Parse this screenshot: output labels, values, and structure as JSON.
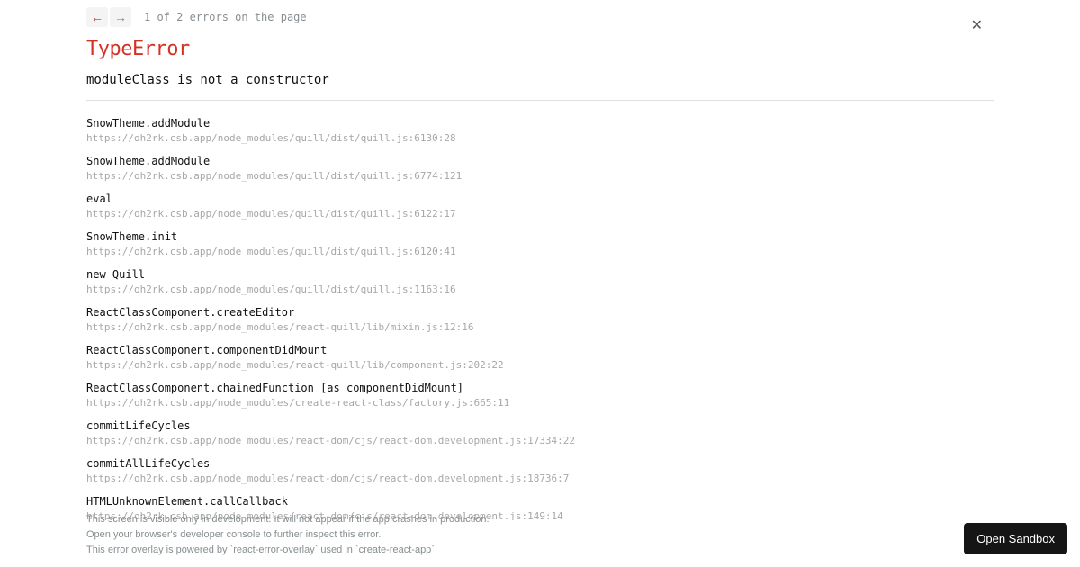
{
  "nav": {
    "prev_glyph": "←",
    "next_glyph": "→",
    "count_label": "1 of 2 errors on the page",
    "close_glyph": "✕"
  },
  "error": {
    "type": "TypeError",
    "message": "moduleClass is not a constructor"
  },
  "frames": [
    {
      "fn": "SnowTheme.addModule",
      "loc": "https://oh2rk.csb.app/node_modules/quill/dist/quill.js:6130:28"
    },
    {
      "fn": "SnowTheme.addModule",
      "loc": "https://oh2rk.csb.app/node_modules/quill/dist/quill.js:6774:121"
    },
    {
      "fn": "eval",
      "loc": "https://oh2rk.csb.app/node_modules/quill/dist/quill.js:6122:17"
    },
    {
      "fn": "SnowTheme.init",
      "loc": "https://oh2rk.csb.app/node_modules/quill/dist/quill.js:6120:41"
    },
    {
      "fn": "new Quill",
      "loc": "https://oh2rk.csb.app/node_modules/quill/dist/quill.js:1163:16"
    },
    {
      "fn": "ReactClassComponent.createEditor",
      "loc": "https://oh2rk.csb.app/node_modules/react-quill/lib/mixin.js:12:16"
    },
    {
      "fn": "ReactClassComponent.componentDidMount",
      "loc": "https://oh2rk.csb.app/node_modules/react-quill/lib/component.js:202:22"
    },
    {
      "fn": "ReactClassComponent.chainedFunction [as componentDidMount]",
      "loc": "https://oh2rk.csb.app/node_modules/create-react-class/factory.js:665:11"
    },
    {
      "fn": "commitLifeCycles",
      "loc": "https://oh2rk.csb.app/node_modules/react-dom/cjs/react-dom.development.js:17334:22"
    },
    {
      "fn": "commitAllLifeCycles",
      "loc": "https://oh2rk.csb.app/node_modules/react-dom/cjs/react-dom.development.js:18736:7"
    },
    {
      "fn": "HTMLUnknownElement.callCallback",
      "loc": "https://oh2rk.csb.app/node_modules/react-dom/cjs/react-dom.development.js:149:14"
    }
  ],
  "footer": {
    "line1": "This screen is visible only in development. It will not appear if the app crashes in production.",
    "line2": "Open your browser's developer console to further inspect this error.",
    "line3": "This error overlay is powered by `react-error-overlay` used in `create-react-app`."
  },
  "sandbox_button": "Open Sandbox"
}
